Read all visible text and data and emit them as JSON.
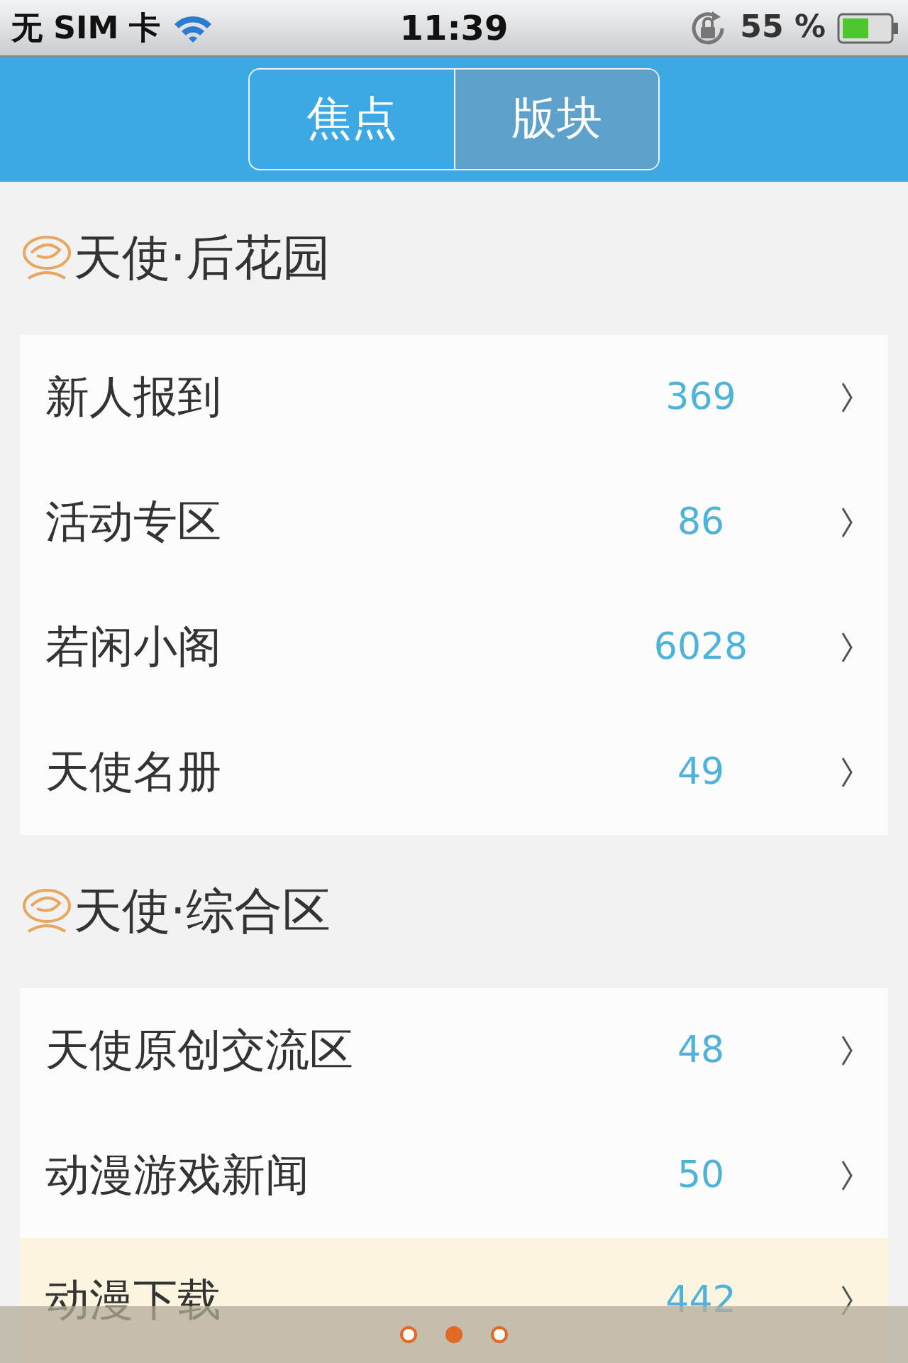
{
  "status_bar": {
    "carrier": "无 SIM 卡",
    "time": "11:39",
    "battery": "55 %"
  },
  "tabs": [
    {
      "label": "焦点",
      "selected": false
    },
    {
      "label": "版块",
      "selected": true
    }
  ],
  "sections": [
    {
      "title": "天使·后花园",
      "items": [
        {
          "name": "新人报到",
          "count": "369",
          "selected": false
        },
        {
          "name": "活动专区",
          "count": "86",
          "selected": false
        },
        {
          "name": "若闲小阁",
          "count": "6028",
          "selected": false
        },
        {
          "name": "天使名册",
          "count": "49",
          "selected": false
        }
      ]
    },
    {
      "title": "天使·综合区",
      "items": [
        {
          "name": "天使原创交流区",
          "count": "48",
          "selected": false
        },
        {
          "name": "动漫游戏新闻",
          "count": "50",
          "selected": false
        },
        {
          "name": "动漫下载",
          "count": "442",
          "selected": true
        }
      ]
    }
  ],
  "pages": [
    {
      "selected": false
    },
    {
      "selected": true
    },
    {
      "selected": false
    }
  ]
}
